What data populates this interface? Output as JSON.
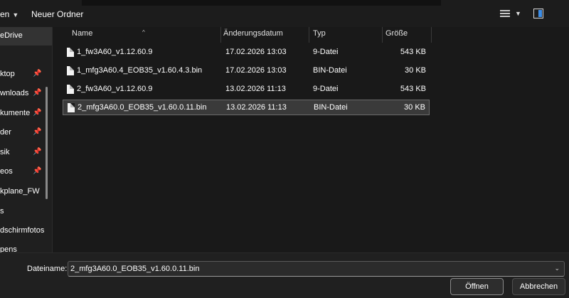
{
  "toolbar": {
    "organize_label": "en",
    "new_folder_label": "Neuer Ordner",
    "view_icon": "list-view-icon",
    "preview_icon": "preview-pane-icon"
  },
  "nav": {
    "items": [
      {
        "label": "eDrive",
        "pinned": false,
        "selected": true
      },
      {
        "label": "ktop",
        "pinned": true
      },
      {
        "label": "wnloads",
        "pinned": true
      },
      {
        "label": "kumente",
        "pinned": true
      },
      {
        "label": "der",
        "pinned": true
      },
      {
        "label": "sik",
        "pinned": true
      },
      {
        "label": "eos",
        "pinned": true
      },
      {
        "label": "kplane_FW",
        "pinned": false
      },
      {
        "label": "s",
        "pinned": false
      },
      {
        "label": "dschirmfotos",
        "pinned": false
      },
      {
        "label": "pens",
        "pinned": false
      }
    ]
  },
  "columns": {
    "name": "Name",
    "date": "Änderungsdatum",
    "type": "Typ",
    "size": "Größe"
  },
  "files": [
    {
      "name": "1_fw3A60_v1.12.60.9",
      "date": "17.02.2026 13:03",
      "type": "9-Datei",
      "size": "543 KB"
    },
    {
      "name": "1_mfg3A60.4_EOB35_v1.60.4.3.bin",
      "date": "17.02.2026 13:03",
      "type": "BIN-Datei",
      "size": "30 KB"
    },
    {
      "name": "2_fw3A60_v1.12.60.9",
      "date": "13.02.2026 11:13",
      "type": "9-Datei",
      "size": "543 KB"
    },
    {
      "name": "2_mfg3A60.0_EOB35_v1.60.0.11.bin",
      "date": "13.02.2026 11:13",
      "type": "BIN-Datei",
      "size": "30 KB",
      "selected": true
    }
  ],
  "bottom": {
    "filename_label": "Dateiname:",
    "filename_value": "2_mfg3A60.0_EOB35_v1.60.0.11.bin",
    "open_label": "Öffnen",
    "cancel_label": "Abbrechen"
  },
  "colors": {
    "background": "#191919",
    "selection": "#3a3a3a",
    "accent": "#3d8ee8"
  }
}
